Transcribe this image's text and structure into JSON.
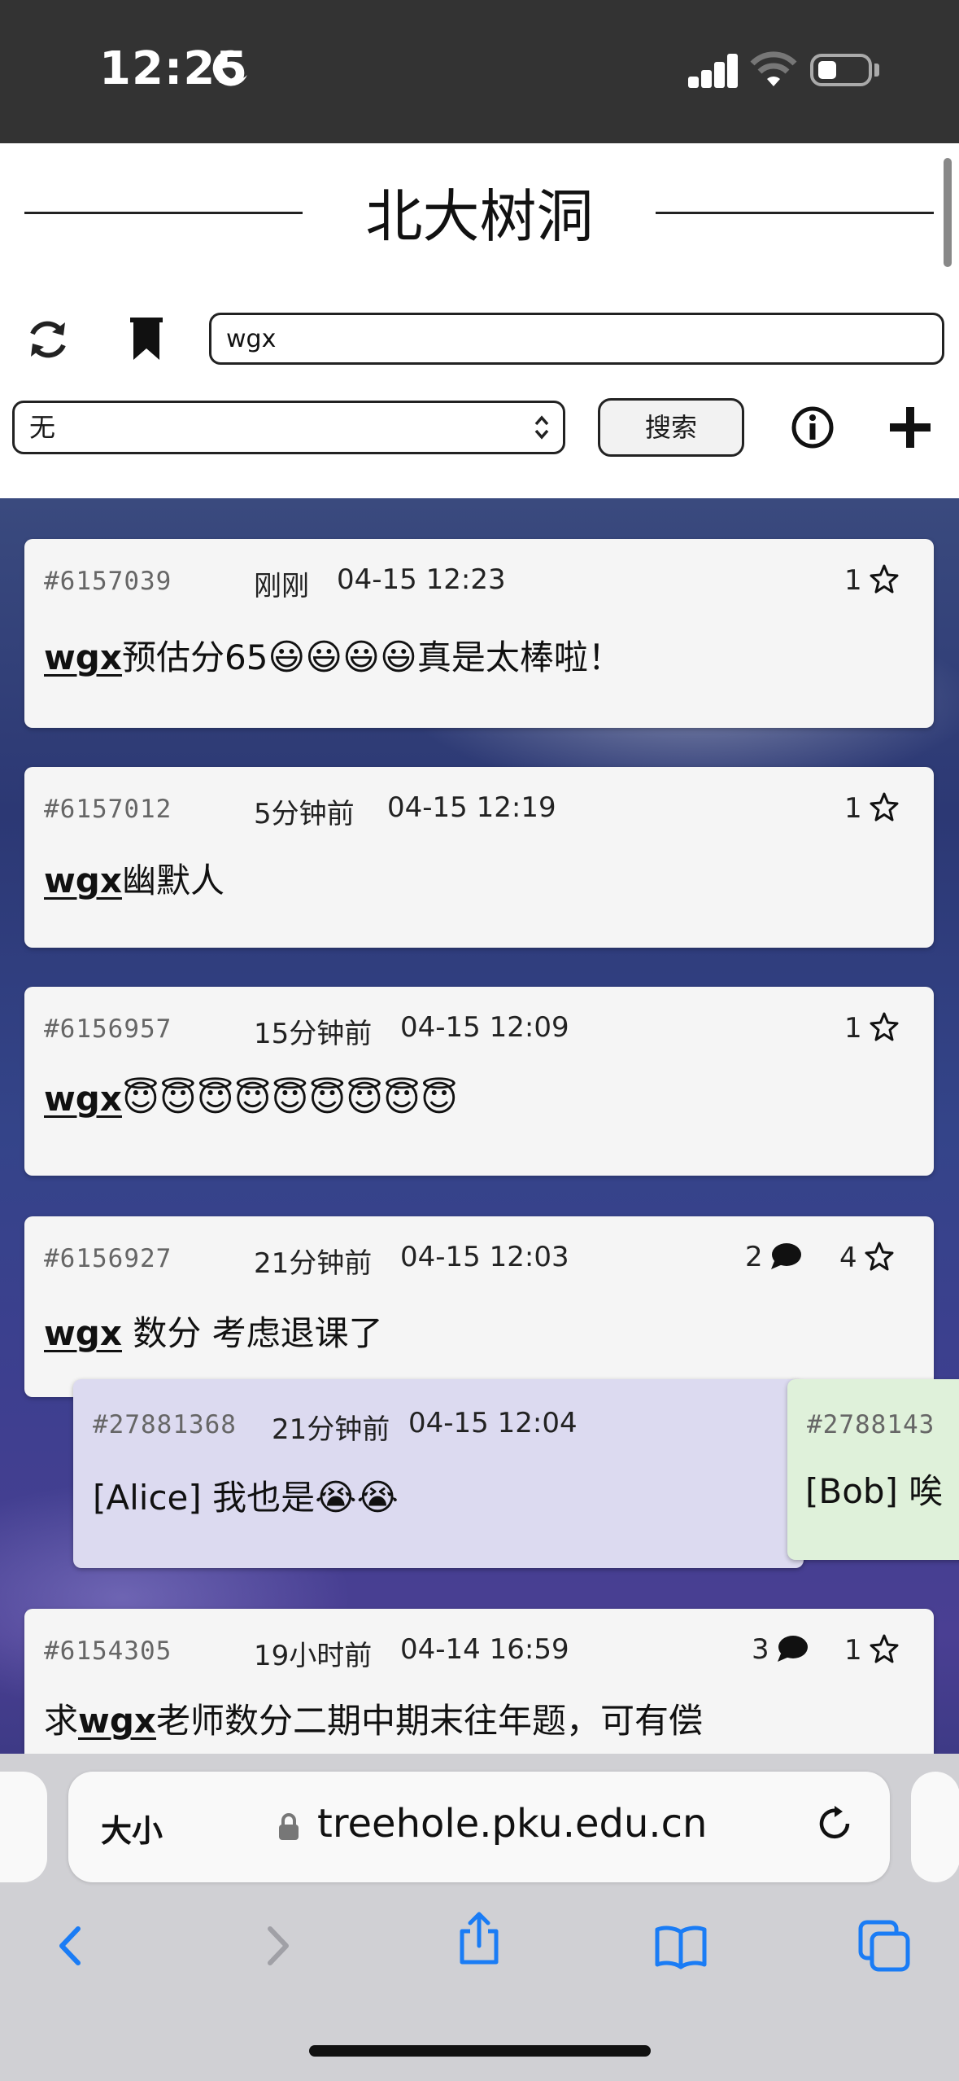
{
  "status": {
    "time": "12:25"
  },
  "app": {
    "title": "北大树洞"
  },
  "search": {
    "value": "wgx",
    "filter_value": "无",
    "button_label": "搜索"
  },
  "posts": [
    {
      "id": "#6157039",
      "relative_time": "刚刚",
      "datetime": "04-15 12:23",
      "comments": "",
      "stars": "1",
      "text_prefix": "",
      "mention": "wgx",
      "text_suffix": "预估分65",
      "emoji": "😃😃😃😃",
      "text_end": "真是太棒啦！"
    },
    {
      "id": "#6157012",
      "relative_time": "5分钟前",
      "datetime": "04-15 12:19",
      "comments": "",
      "stars": "1",
      "text_prefix": "",
      "mention": "wgx",
      "text_suffix": "幽默人",
      "emoji": "",
      "text_end": ""
    },
    {
      "id": "#6156957",
      "relative_time": "15分钟前",
      "datetime": "04-15 12:09",
      "comments": "",
      "stars": "1",
      "text_prefix": "",
      "mention": "wgx",
      "text_suffix": "",
      "emoji": "😇😇😇😇😇😇😇😇😇",
      "text_end": ""
    },
    {
      "id": "#6156927",
      "relative_time": "21分钟前",
      "datetime": "04-15 12:03",
      "comments": "2",
      "stars": "4",
      "text_prefix": "",
      "mention": "wgx",
      "text_suffix": " 数分 考虑退课了",
      "emoji": "",
      "text_end": ""
    },
    {
      "id": "#6154305",
      "relative_time": "19小时前",
      "datetime": "04-14 16:59",
      "comments": "3",
      "stars": "1",
      "text_prefix": "求",
      "mention": "wgx",
      "text_suffix": "老师数分二期中期末往年题，可有偿",
      "emoji": "",
      "text_end": ""
    }
  ],
  "replies": [
    {
      "id": "#27881368",
      "relative_time": "21分钟前",
      "datetime": "04-15 12:04",
      "text": "[Alice] 我也是",
      "emoji": "😭😭",
      "color": "#dcdaf0"
    },
    {
      "id": "#2788143",
      "text": "[Bob] 唉",
      "color": "#dff1da"
    }
  ],
  "browser": {
    "text_size_label": "大小",
    "url": "treehole.pku.edu.cn"
  },
  "icons": [
    "moon-icon",
    "cellular-signal-icon",
    "wifi-icon",
    "battery-icon",
    "refresh-icon",
    "bookmark-icon",
    "info-icon",
    "plus-icon",
    "star-icon",
    "comment-icon",
    "lock-icon",
    "reload-icon",
    "back-icon",
    "forward-icon",
    "share-icon",
    "bookmarks-icon",
    "tabs-icon"
  ]
}
